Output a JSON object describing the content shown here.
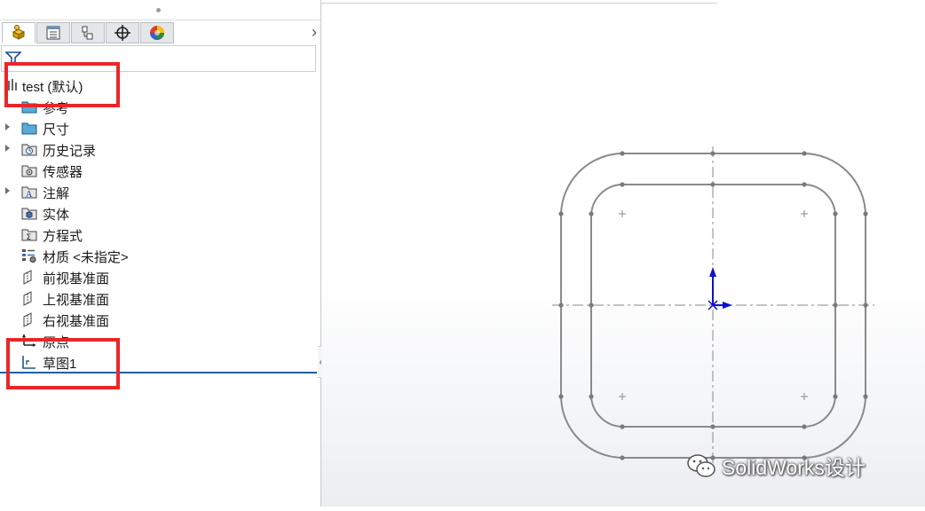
{
  "feature_tree": {
    "tabs": [
      {
        "name": "featuremanager-tab",
        "icon": "feature-manager-icon",
        "active": true
      },
      {
        "name": "propertymanager-tab",
        "icon": "property-manager-icon",
        "active": false
      },
      {
        "name": "configurationmanager-tab",
        "icon": "configuration-manager-icon",
        "active": false
      },
      {
        "name": "dimxpert-tab",
        "icon": "crosshair-icon",
        "active": false
      },
      {
        "name": "displaymanager-tab",
        "icon": "appearance-icon",
        "active": false
      }
    ],
    "root": {
      "label": "test  (默认)",
      "icon": "part-icon"
    },
    "items": [
      {
        "label": "参考",
        "icon": "folder-icon",
        "expandable": false
      },
      {
        "label": "尺寸",
        "icon": "folder-icon",
        "expandable": true
      },
      {
        "label": "历史记录",
        "icon": "history-icon",
        "expandable": true
      },
      {
        "label": "传感器",
        "icon": "sensor-icon",
        "expandable": false
      },
      {
        "label": "注解",
        "icon": "annotation-icon",
        "expandable": true
      },
      {
        "label": "实体",
        "icon": "solid-body-icon",
        "expandable": false
      },
      {
        "label": "方程式",
        "icon": "equation-icon",
        "expandable": false
      },
      {
        "label": "材质 <未指定>",
        "icon": "material-icon",
        "expandable": false
      },
      {
        "label": "前视基准面",
        "icon": "plane-icon",
        "expandable": false
      },
      {
        "label": "上视基准面",
        "icon": "plane-icon",
        "expandable": false
      },
      {
        "label": "右视基准面",
        "icon": "plane-icon",
        "expandable": false
      },
      {
        "label": "原点",
        "icon": "origin-icon",
        "expandable": false
      },
      {
        "label": "草图1",
        "icon": "sketch-icon",
        "expandable": false
      }
    ]
  },
  "watermark": {
    "text": "SolidWorks设计",
    "icon": "wechat-icon"
  },
  "colors": {
    "highlight": "#e8262a",
    "sketch_line": "#8a8a8a",
    "axis_arrow": "#1010d0",
    "rollback_bar": "#1f5ea8"
  }
}
